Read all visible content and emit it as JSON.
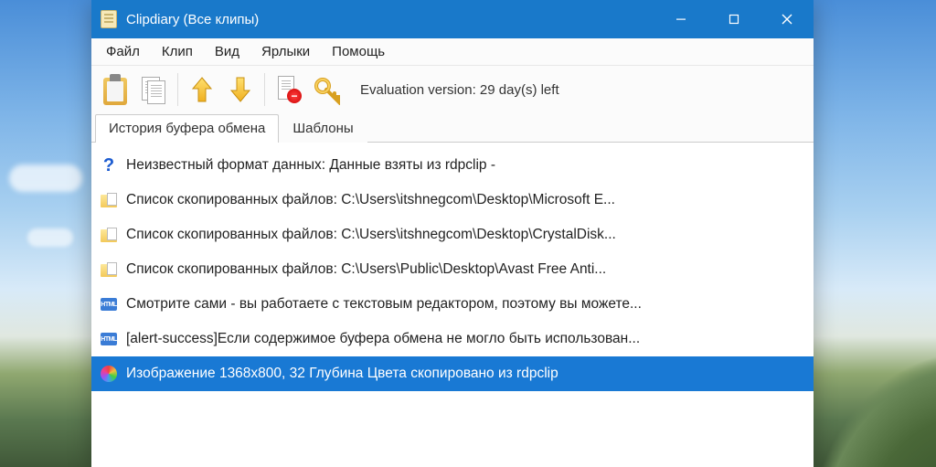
{
  "titlebar": {
    "title": "Clipdiary (Все клипы)"
  },
  "menu": {
    "file": "Файл",
    "clip": "Клип",
    "view": "Вид",
    "shortcuts": "Ярлыки",
    "help": "Помощь"
  },
  "toolbar": {
    "eval_text": "Evaluation version: 29 day(s) left"
  },
  "tabs": {
    "history": "История буфера обмена",
    "templates": "Шаблоны"
  },
  "rows": [
    {
      "icon": "question",
      "text": "Неизвестный формат данных: Данные взяты из rdpclip -"
    },
    {
      "icon": "files",
      "text": "Список скопированных файлов:   C:\\Users\\itshnegcom\\Desktop\\Microsoft E..."
    },
    {
      "icon": "files",
      "text": "Список скопированных файлов:   C:\\Users\\itshnegcom\\Desktop\\CrystalDisk..."
    },
    {
      "icon": "files",
      "text": "Список скопированных файлов:   C:\\Users\\Public\\Desktop\\Avast Free Anti..."
    },
    {
      "icon": "html",
      "text": "Смотрите сами - вы работаете с текстовым редактором, поэтому вы можете..."
    },
    {
      "icon": "html",
      "text": "[alert-success]Если содержимое буфера обмена не могло быть использован..."
    },
    {
      "icon": "image",
      "text": "Изображение 1368x800, 32 Глубина Цвета скопировано из rdpclip",
      "selected": true
    }
  ]
}
